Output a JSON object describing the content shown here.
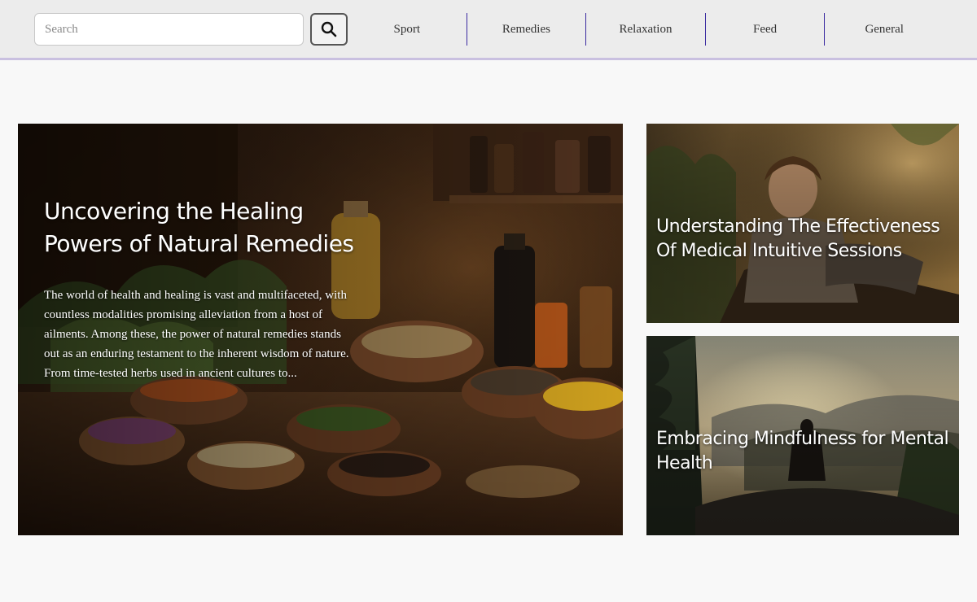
{
  "search": {
    "placeholder": "Search",
    "button_icon": "search-icon"
  },
  "nav": {
    "items": [
      {
        "label": "Sport"
      },
      {
        "label": "Remedies"
      },
      {
        "label": "Relaxation"
      },
      {
        "label": "Feed"
      },
      {
        "label": "General"
      }
    ]
  },
  "featured": {
    "title": "Uncovering the Healing Powers of Natural Remedies",
    "excerpt": "The world of health and healing is vast and multifaceted, with countless modalities promising alleviation from a host of ailments. Among these, the power of natural remedies stands out as an enduring testament to the inherent wisdom of nature. From time-tested herbs used in ancient cultures to..."
  },
  "side_articles": [
    {
      "title": "Understanding The Effectiveness Of Medical Intuitive Sessions"
    },
    {
      "title": "Embracing Mindfulness for Mental Health"
    }
  ],
  "colors": {
    "topbar": "#ececec",
    "topbar_border": "#c9c0e0",
    "nav_divider": "#3a2aa0",
    "page_background": "#f8f8f8"
  }
}
